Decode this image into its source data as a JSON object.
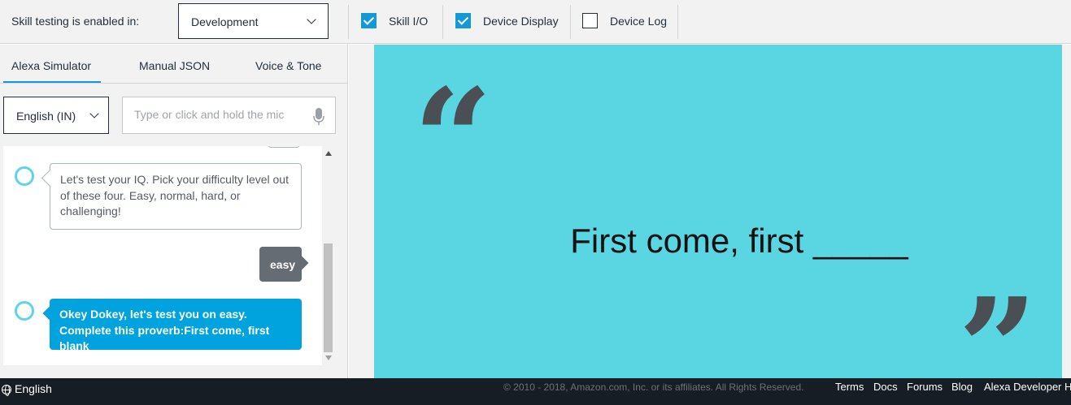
{
  "toolbar": {
    "enabled_label": "Skill testing is enabled in:",
    "environment": "Development",
    "checkboxes": [
      {
        "label": "Skill I/O",
        "checked": true
      },
      {
        "label": "Device Display",
        "checked": true
      },
      {
        "label": "Device Log",
        "checked": false
      }
    ]
  },
  "tabs": [
    {
      "label": "Alexa Simulator",
      "active": true
    },
    {
      "label": "Manual JSON",
      "active": false
    },
    {
      "label": "Voice & Tone",
      "active": false
    }
  ],
  "language": "English (IN)",
  "utterance": {
    "placeholder": "Type or click and hold the mic",
    "value": ""
  },
  "chat": [
    {
      "speaker": "alexa",
      "text": "Let's test your IQ. Pick your difficulty level out of these four. Easy, normal, hard, or challenging!"
    },
    {
      "speaker": "user",
      "text": "easy"
    },
    {
      "speaker": "alexa",
      "text": "Okey Dokey, let's test you on easy. Complete this proverb:First come, first blank"
    }
  ],
  "display": {
    "question": "First come, first _____",
    "background": "#5ad5e2",
    "quote_color": "#4a4f55"
  },
  "footer": {
    "language": "English",
    "copyright": "© 2010 - 2018, Amazon.com, Inc. or its affiliates. All Rights Reserved.",
    "links": [
      "Terms",
      "Docs",
      "Forums",
      "Blog",
      "Alexa Developer Home"
    ]
  },
  "colors": {
    "accent": "#1399d6",
    "alexa_bubble": "#00a3dd",
    "user_bubble": "#656c73",
    "footer_bg": "#171d24"
  }
}
